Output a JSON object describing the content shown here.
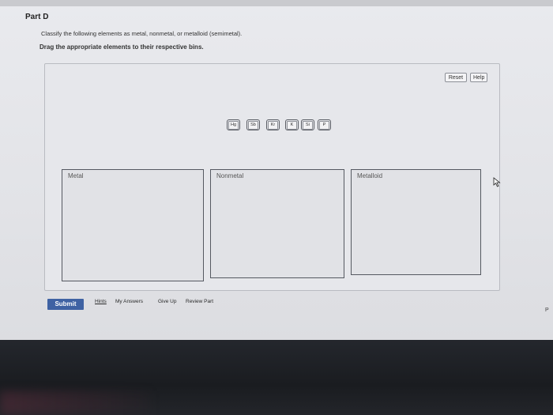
{
  "part": {
    "title": "Part D"
  },
  "instructions": {
    "line1": "Classify the following elements as metal, nonmetal, or metalloid (semimetal).",
    "line2": "Drag the appropriate elements to their respective bins."
  },
  "toolbar": {
    "reset_label": "Reset",
    "help_label": "Help"
  },
  "elements": [
    "Hg",
    "Sb",
    "Kr",
    "K",
    "Si",
    "P"
  ],
  "bins": {
    "metal": "Metal",
    "nonmetal": "Nonmetal",
    "metalloid": "Metalloid"
  },
  "footer": {
    "submit_label": "Submit",
    "hints_label": "Hints",
    "my_answers_label": "My Answers",
    "give_up_label": "Give Up",
    "review_part_label": "Review Part"
  },
  "edge": {
    "partial_text": "P"
  }
}
